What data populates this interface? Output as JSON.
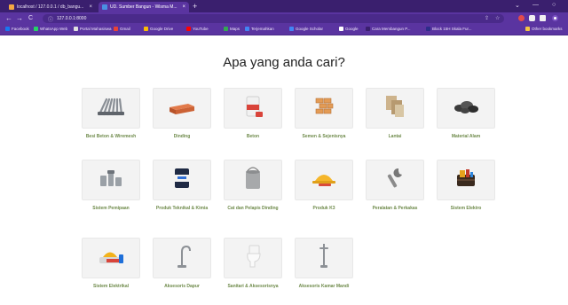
{
  "browser": {
    "tabs": [
      {
        "title": "localhost / 127.0.0.1 / db_bangu...",
        "active": false
      },
      {
        "title": "UD. Sumber Bangun - Wisma M...",
        "active": true
      }
    ],
    "new_tab": "+",
    "window_controls": {
      "minimize": "⌄",
      "maximize": "—",
      "close": "○"
    },
    "nav": {
      "back": "←",
      "forward": "→",
      "reload": "C"
    },
    "url": "127.0.0.1:8000",
    "bookmarks": [
      {
        "label": "Facebook",
        "color": "#1877f2"
      },
      {
        "label": "WhatsApp Web",
        "color": "#25d366"
      },
      {
        "label": "Portal Mahasiswa",
        "color": "#e0e0e0"
      },
      {
        "label": "Gmail",
        "color": "#ea4335"
      },
      {
        "label": "Google Drive",
        "color": "#fbbc04"
      },
      {
        "label": "YouTube",
        "color": "#ff0000"
      },
      {
        "label": "Maps",
        "color": "#34a853"
      },
      {
        "label": "Terjemahkan",
        "color": "#4285f4"
      },
      {
        "label": "Google Scholar",
        "color": "#4285f4"
      },
      {
        "label": "Google",
        "color": "#ffffff"
      },
      {
        "label": "Cara Membangun P...",
        "color": "#3a1f6e"
      },
      {
        "label": "Block 15H Skala Fur...",
        "color": "#2d2d8a"
      }
    ],
    "other_bookmarks": "Other bookmarks"
  },
  "page": {
    "heading": "Apa yang anda cari?"
  },
  "categories": [
    {
      "label": "Besi Beton & Wiremesh",
      "icon": "steel-bars-icon"
    },
    {
      "label": "Dinding",
      "icon": "brick-icon"
    },
    {
      "label": "Beton",
      "icon": "cement-bag-icon"
    },
    {
      "label": "Semen & Sejenisnya",
      "icon": "bricks-stack-icon"
    },
    {
      "label": "Lantai",
      "icon": "tiles-icon"
    },
    {
      "label": "Material Alam",
      "icon": "stones-icon"
    },
    {
      "label": "Sistem Pemipaan",
      "icon": "pipe-fittings-icon"
    },
    {
      "label": "Produk Teknikal & Kimia",
      "icon": "chemical-bucket-icon"
    },
    {
      "label": "Cat dan Pelapis Dinding",
      "icon": "paint-can-icon"
    },
    {
      "label": "Produk K3",
      "icon": "safety-helmet-icon"
    },
    {
      "label": "Peralatan & Perkakas",
      "icon": "wrench-icon"
    },
    {
      "label": "Sistem Elektro",
      "icon": "toolbox-icon"
    },
    {
      "label": "Sistem Elektrikal",
      "icon": "electrical-kit-icon"
    },
    {
      "label": "Aksesoris Dapur",
      "icon": "kitchen-faucet-icon"
    },
    {
      "label": "Sanitari & Aksesorisnya",
      "icon": "toilet-icon"
    },
    {
      "label": "Aksesoris Kamar Mandi",
      "icon": "shower-icon"
    }
  ]
}
